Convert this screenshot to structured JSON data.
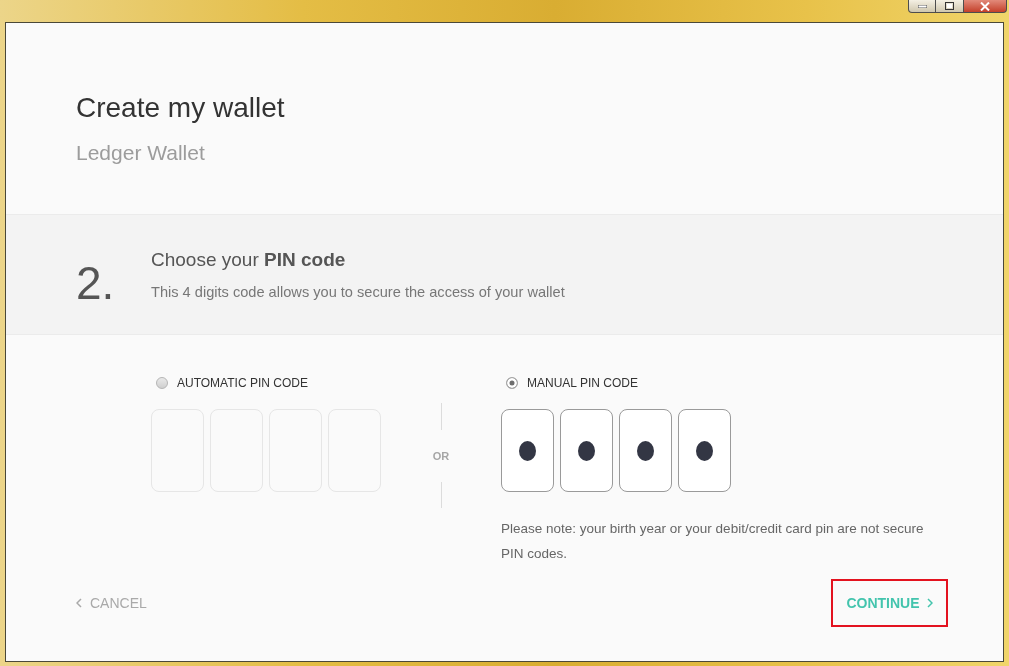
{
  "header": {
    "title": "Create my wallet",
    "subtitle": "Ledger Wallet"
  },
  "step": {
    "number": "2.",
    "title": "Choose your **PIN code**",
    "description": "This 4 digits code allows you to secure the access of your wallet"
  },
  "options": [
    {
      "label": "AUTOMATIC PIN CODE",
      "selected": false,
      "digits": [
        {
          "filled": false
        },
        {
          "filled": false
        },
        {
          "filled": false
        },
        {
          "filled": false
        }
      ]
    },
    {
      "label": "MANUAL PIN CODE",
      "selected": true,
      "digits": [
        {
          "filled": true
        },
        {
          "filled": true
        },
        {
          "filled": true
        },
        {
          "filled": true
        }
      ],
      "note": "Please note: your birth year or your debit/credit card pin are not secure PIN codes."
    }
  ],
  "separator": "OR",
  "footer": {
    "cancel": "CANCEL",
    "continue": {
      "label": "CONTINUE",
      "highlighted": true
    }
  }
}
